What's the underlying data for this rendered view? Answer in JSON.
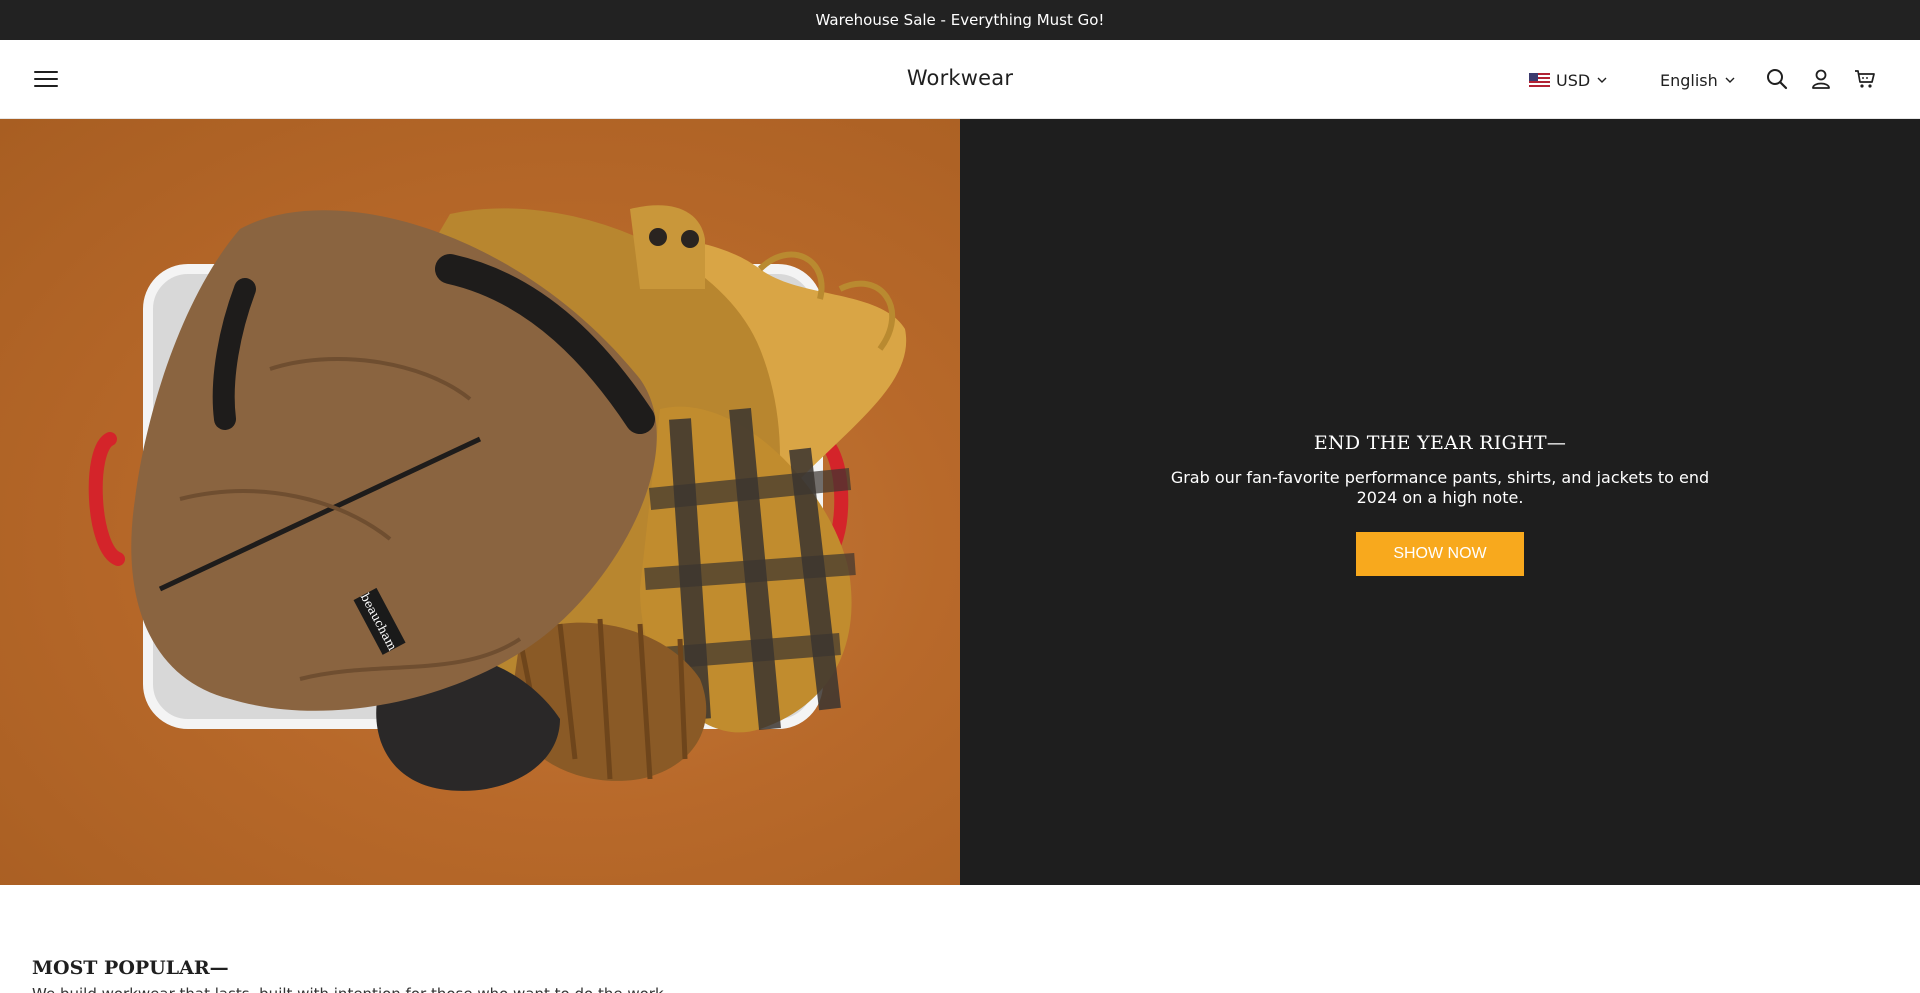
{
  "announcement": {
    "text": "Warehouse Sale - Everything Must Go!"
  },
  "header": {
    "brand": "Workwear",
    "currency": "USD",
    "language": "English",
    "icons": [
      "menu-icon",
      "us-flag-icon",
      "chevron-down-icon",
      "search-icon",
      "account-icon",
      "cart-icon"
    ]
  },
  "hero": {
    "title": "END THE YEAR RIGHT—",
    "text": "Grab our fan-favorite performance pants, shirts, and jackets to end 2024 on a high note.",
    "cta": "SHOW NOW",
    "image_label": "beaucham"
  },
  "most_popular": {
    "title": "MOST POPULAR—",
    "subtitle": "We build workwear that lasts, built with intention for those who want to do the work."
  },
  "colors": {
    "announcement_bg": "#222222",
    "hero_panel_bg": "#1e1e1e",
    "cta_bg": "#f8a91d",
    "hero_image_bg": "#b8692a"
  }
}
